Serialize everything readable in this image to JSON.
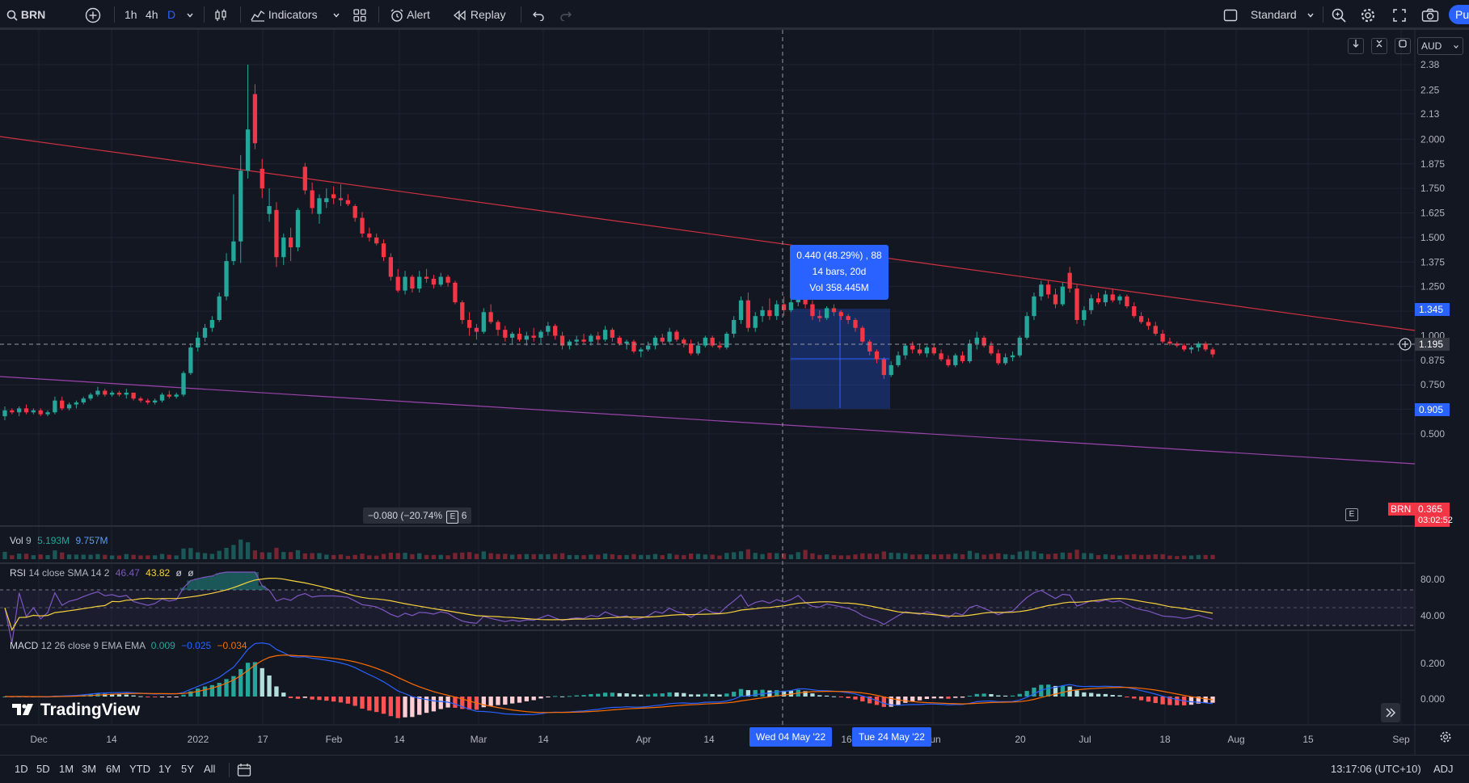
{
  "toolbar": {
    "symbol": "BRN",
    "intervals": [
      "1h",
      "4h",
      "D"
    ],
    "indicators_label": "Indicators",
    "alert_label": "Alert",
    "replay_label": "Replay",
    "layout_label": "Standard",
    "publish_label": "Pu"
  },
  "price_axis": {
    "currency": "AUD",
    "ticks": [
      "2.38",
      "2.25",
      "2.13",
      "2.000",
      "1.875",
      "1.750",
      "1.625",
      "1.500",
      "1.375",
      "1.250",
      "1.125",
      "1.000",
      "0.875",
      "0.750",
      "0.625",
      "0.500"
    ],
    "tag_high": "1.345",
    "tag_cross": "1.195",
    "tag_last": "0.905",
    "symbol_tag": "BRN",
    "countdown_value": "0.365",
    "countdown_time": "03:02:52"
  },
  "time_axis": {
    "labels": [
      "Dec",
      "14",
      "2022",
      "17",
      "Feb",
      "14",
      "Mar",
      "14",
      "Apr",
      "14",
      "16",
      "Jun",
      "20",
      "Jul",
      "18",
      "Aug",
      "15",
      "Sep"
    ],
    "cross_start": "Wed 04 May '22",
    "cross_end": "Tue 24 May '22"
  },
  "measure": {
    "line1": "0.440 (48.29%) , 88",
    "line2": "14 bars, 20d",
    "line3": "Vol 358.445M"
  },
  "small_measure": {
    "text": "−0.080 (−20.74%",
    "suffix": "6"
  },
  "volume": {
    "title": "Vol",
    "length": "9",
    "v1": "5.193M",
    "v2": "9.757M"
  },
  "rsi": {
    "title": "RSI",
    "params": "14 close SMA 14 2",
    "v1": "46.47",
    "v2": "43.82",
    "v3": "ø",
    "v4": "ø",
    "ticks": [
      "80.00",
      "40.00"
    ]
  },
  "macd": {
    "title": "MACD",
    "params": "12 26 close 9 EMA EMA",
    "v1": "0.009",
    "v2": "−0.025",
    "v3": "−0.034",
    "ticks": [
      "0.200",
      "0.000"
    ]
  },
  "ranges": [
    "1D",
    "5D",
    "1M",
    "3M",
    "6M",
    "YTD",
    "1Y",
    "5Y",
    "All"
  ],
  "clock": "13:17:06 (UTC+10)",
  "adj": "ADJ",
  "watermark": "TradingView",
  "e_tag": "E",
  "colors": {
    "bg": "#131722",
    "up": "#26a69a",
    "down": "#f23645",
    "accent": "#2962ff",
    "rsi": "#7e57c2",
    "ma": "#f7d23d",
    "macd": "#2962ff",
    "signal": "#ff6d00"
  },
  "chart_data": {
    "type": "candlestick",
    "price_range": [
      0.5,
      2.4
    ],
    "candles": [
      [
        0.59,
        0.64,
        0.57,
        0.62
      ],
      [
        0.62,
        0.63,
        0.6,
        0.61
      ],
      [
        0.61,
        0.64,
        0.59,
        0.63
      ],
      [
        0.63,
        0.65,
        0.6,
        0.61
      ],
      [
        0.61,
        0.63,
        0.6,
        0.62
      ],
      [
        0.62,
        0.63,
        0.59,
        0.6
      ],
      [
        0.6,
        0.62,
        0.59,
        0.61
      ],
      [
        0.61,
        0.69,
        0.6,
        0.67
      ],
      [
        0.67,
        0.69,
        0.62,
        0.63
      ],
      [
        0.63,
        0.66,
        0.62,
        0.65
      ],
      [
        0.65,
        0.67,
        0.63,
        0.66
      ],
      [
        0.66,
        0.69,
        0.65,
        0.68
      ],
      [
        0.68,
        0.71,
        0.67,
        0.7
      ],
      [
        0.7,
        0.74,
        0.69,
        0.72
      ],
      [
        0.72,
        0.73,
        0.69,
        0.7
      ],
      [
        0.7,
        0.72,
        0.69,
        0.71
      ],
      [
        0.71,
        0.72,
        0.69,
        0.7
      ],
      [
        0.7,
        0.73,
        0.68,
        0.71
      ],
      [
        0.71,
        0.71,
        0.67,
        0.68
      ],
      [
        0.68,
        0.69,
        0.66,
        0.67
      ],
      [
        0.67,
        0.68,
        0.65,
        0.66
      ],
      [
        0.66,
        0.68,
        0.65,
        0.67
      ],
      [
        0.67,
        0.71,
        0.66,
        0.7
      ],
      [
        0.7,
        0.72,
        0.68,
        0.69
      ],
      [
        0.69,
        0.71,
        0.68,
        0.7
      ],
      [
        0.7,
        0.82,
        0.69,
        0.81
      ],
      [
        0.81,
        0.96,
        0.8,
        0.94
      ],
      [
        0.94,
        1.02,
        0.92,
        0.99
      ],
      [
        0.99,
        1.06,
        0.97,
        1.04
      ],
      [
        1.04,
        1.1,
        1.02,
        1.08
      ],
      [
        1.08,
        1.22,
        1.07,
        1.2
      ],
      [
        1.2,
        1.42,
        1.18,
        1.38
      ],
      [
        1.38,
        1.72,
        1.36,
        1.48
      ],
      [
        1.48,
        1.92,
        1.37,
        1.84
      ],
      [
        1.84,
        2.38,
        1.8,
        2.05
      ],
      [
        2.23,
        2.28,
        1.95,
        1.98
      ],
      [
        1.85,
        1.9,
        1.7,
        1.75
      ],
      [
        1.62,
        1.75,
        1.58,
        1.66
      ],
      [
        1.64,
        1.68,
        1.35,
        1.4
      ],
      [
        1.4,
        1.52,
        1.36,
        1.5
      ],
      [
        1.5,
        1.55,
        1.38,
        1.45
      ],
      [
        1.45,
        1.65,
        1.43,
        1.64
      ],
      [
        1.86,
        1.88,
        1.72,
        1.74
      ],
      [
        1.74,
        1.78,
        1.62,
        1.65
      ],
      [
        1.62,
        1.72,
        1.57,
        1.7
      ],
      [
        1.68,
        1.75,
        1.65,
        1.7
      ],
      [
        1.72,
        1.76,
        1.67,
        1.7
      ],
      [
        1.7,
        1.77,
        1.66,
        1.69
      ],
      [
        1.69,
        1.72,
        1.66,
        1.67
      ],
      [
        1.66,
        1.67,
        1.58,
        1.6
      ],
      [
        1.6,
        1.63,
        1.5,
        1.52
      ],
      [
        1.52,
        1.55,
        1.48,
        1.5
      ],
      [
        1.5,
        1.52,
        1.46,
        1.47
      ],
      [
        1.47,
        1.49,
        1.38,
        1.4
      ],
      [
        1.4,
        1.42,
        1.28,
        1.3
      ],
      [
        1.3,
        1.34,
        1.22,
        1.23
      ],
      [
        1.23,
        1.33,
        1.21,
        1.3
      ],
      [
        1.3,
        1.31,
        1.22,
        1.24
      ],
      [
        1.24,
        1.33,
        1.22,
        1.3
      ],
      [
        1.3,
        1.34,
        1.27,
        1.29
      ],
      [
        1.29,
        1.31,
        1.24,
        1.26
      ],
      [
        1.26,
        1.32,
        1.25,
        1.3
      ],
      [
        1.3,
        1.31,
        1.25,
        1.27
      ],
      [
        1.27,
        1.28,
        1.16,
        1.17
      ],
      [
        1.17,
        1.18,
        1.06,
        1.08
      ],
      [
        1.08,
        1.12,
        1.0,
        1.04
      ],
      [
        1.04,
        1.06,
        0.98,
        1.02
      ],
      [
        1.02,
        1.14,
        1.01,
        1.12
      ],
      [
        1.12,
        1.16,
        1.06,
        1.07
      ],
      [
        1.07,
        1.08,
        1.0,
        1.03
      ],
      [
        1.03,
        1.05,
        0.97,
        0.99
      ],
      [
        0.99,
        1.02,
        0.96,
        1.01
      ],
      [
        1.01,
        1.04,
        0.97,
        0.98
      ],
      [
        0.98,
        1.02,
        0.95,
        1.0
      ],
      [
        1.0,
        1.04,
        0.97,
        0.99
      ],
      [
        0.99,
        1.03,
        0.96,
        1.02
      ],
      [
        1.02,
        1.07,
        1.0,
        1.05
      ],
      [
        1.05,
        1.06,
        0.98,
        1.0
      ],
      [
        1.0,
        1.02,
        0.93,
        0.95
      ],
      [
        0.95,
        0.98,
        0.93,
        0.97
      ],
      [
        0.97,
        1.0,
        0.95,
        0.98
      ],
      [
        0.98,
        1.01,
        0.96,
        0.97
      ],
      [
        0.97,
        1.01,
        0.95,
        1.0
      ],
      [
        1.0,
        1.02,
        0.96,
        0.98
      ],
      [
        0.98,
        1.05,
        0.97,
        1.03
      ],
      [
        1.03,
        1.04,
        0.97,
        0.99
      ],
      [
        0.99,
        1.0,
        0.95,
        0.96
      ],
      [
        0.96,
        0.98,
        0.93,
        0.97
      ],
      [
        0.97,
        0.98,
        0.91,
        0.92
      ],
      [
        0.92,
        0.94,
        0.89,
        0.93
      ],
      [
        0.93,
        0.97,
        0.92,
        0.95
      ],
      [
        0.95,
        1.0,
        0.93,
        0.99
      ],
      [
        0.99,
        1.01,
        0.96,
        0.97
      ],
      [
        0.97,
        1.04,
        0.96,
        1.02
      ],
      [
        1.02,
        1.03,
        0.97,
        0.98
      ],
      [
        0.98,
        0.99,
        0.94,
        0.96
      ],
      [
        0.96,
        0.98,
        0.9,
        0.91
      ],
      [
        0.91,
        0.97,
        0.9,
        0.95
      ],
      [
        0.95,
        1.0,
        0.94,
        0.99
      ],
      [
        0.99,
        1.0,
        0.94,
        0.95
      ],
      [
        0.95,
        0.97,
        0.93,
        0.94
      ],
      [
        0.94,
        1.02,
        0.93,
        1.01
      ],
      [
        1.01,
        1.1,
        0.99,
        1.08
      ],
      [
        1.08,
        1.2,
        1.06,
        1.18
      ],
      [
        1.18,
        1.22,
        1.02,
        1.04
      ],
      [
        1.04,
        1.12,
        1.02,
        1.1
      ],
      [
        1.1,
        1.15,
        1.07,
        1.13
      ],
      [
        1.13,
        1.19,
        1.08,
        1.1
      ],
      [
        1.1,
        1.18,
        1.08,
        1.16
      ],
      [
        1.16,
        1.2,
        1.1,
        1.13
      ],
      [
        1.13,
        1.19,
        1.12,
        1.17
      ],
      [
        1.17,
        1.28,
        1.15,
        1.25
      ],
      [
        1.33,
        1.35,
        1.14,
        1.16
      ],
      [
        1.16,
        1.18,
        1.08,
        1.1
      ],
      [
        1.1,
        1.13,
        1.07,
        1.09
      ],
      [
        1.09,
        1.15,
        1.08,
        1.14
      ],
      [
        1.14,
        1.16,
        1.1,
        1.12
      ],
      [
        1.12,
        1.13,
        1.08,
        1.1
      ],
      [
        1.1,
        1.11,
        1.06,
        1.08
      ],
      [
        1.08,
        1.09,
        1.02,
        1.04
      ],
      [
        1.04,
        1.05,
        0.96,
        0.97
      ],
      [
        0.97,
        0.98,
        0.9,
        0.92
      ],
      [
        0.92,
        0.93,
        0.86,
        0.88
      ],
      [
        0.88,
        0.89,
        0.78,
        0.8
      ],
      [
        0.8,
        0.87,
        0.79,
        0.85
      ],
      [
        0.85,
        0.92,
        0.84,
        0.9
      ],
      [
        0.9,
        0.96,
        0.88,
        0.95
      ],
      [
        0.95,
        0.97,
        0.91,
        0.93
      ],
      [
        0.93,
        0.96,
        0.9,
        0.91
      ],
      [
        0.91,
        0.95,
        0.89,
        0.94
      ],
      [
        0.94,
        0.96,
        0.9,
        0.91
      ],
      [
        0.91,
        0.93,
        0.87,
        0.88
      ],
      [
        0.88,
        0.9,
        0.84,
        0.85
      ],
      [
        0.85,
        0.91,
        0.84,
        0.9
      ],
      [
        0.9,
        0.92,
        0.86,
        0.87
      ],
      [
        0.87,
        0.98,
        0.86,
        0.96
      ],
      [
        0.96,
        1.02,
        0.93,
        0.99
      ],
      [
        0.99,
        1.0,
        0.94,
        0.95
      ],
      [
        0.95,
        0.97,
        0.9,
        0.91
      ],
      [
        0.91,
        0.93,
        0.85,
        0.86
      ],
      [
        0.86,
        0.91,
        0.85,
        0.89
      ],
      [
        0.89,
        0.92,
        0.87,
        0.9
      ],
      [
        0.9,
        1.0,
        0.89,
        0.99
      ],
      [
        0.99,
        1.12,
        0.98,
        1.1
      ],
      [
        1.1,
        1.22,
        1.08,
        1.2
      ],
      [
        1.2,
        1.28,
        1.18,
        1.26
      ],
      [
        1.26,
        1.28,
        1.19,
        1.21
      ],
      [
        1.21,
        1.24,
        1.14,
        1.16
      ],
      [
        1.16,
        1.27,
        1.15,
        1.25
      ],
      [
        1.32,
        1.35,
        1.22,
        1.24
      ],
      [
        1.24,
        1.26,
        1.06,
        1.08
      ],
      [
        1.08,
        1.15,
        1.05,
        1.13
      ],
      [
        1.13,
        1.21,
        1.11,
        1.19
      ],
      [
        1.19,
        1.22,
        1.16,
        1.17
      ],
      [
        1.17,
        1.23,
        1.15,
        1.21
      ],
      [
        1.21,
        1.24,
        1.17,
        1.18
      ],
      [
        1.18,
        1.21,
        1.16,
        1.2
      ],
      [
        1.2,
        1.21,
        1.14,
        1.15
      ],
      [
        1.15,
        1.17,
        1.09,
        1.1
      ],
      [
        1.1,
        1.12,
        1.06,
        1.07
      ],
      [
        1.07,
        1.09,
        1.03,
        1.05
      ],
      [
        1.05,
        1.07,
        1.0,
        1.01
      ],
      [
        1.01,
        1.03,
        0.96,
        0.97
      ],
      [
        0.97,
        0.99,
        0.95,
        0.96
      ],
      [
        0.96,
        0.97,
        0.94,
        0.95
      ],
      [
        0.95,
        0.96,
        0.92,
        0.93
      ],
      [
        0.93,
        0.95,
        0.91,
        0.94
      ],
      [
        0.94,
        0.97,
        0.92,
        0.96
      ],
      [
        0.96,
        0.97,
        0.92,
        0.93
      ],
      [
        0.93,
        0.94,
        0.89,
        0.905
      ]
    ]
  }
}
